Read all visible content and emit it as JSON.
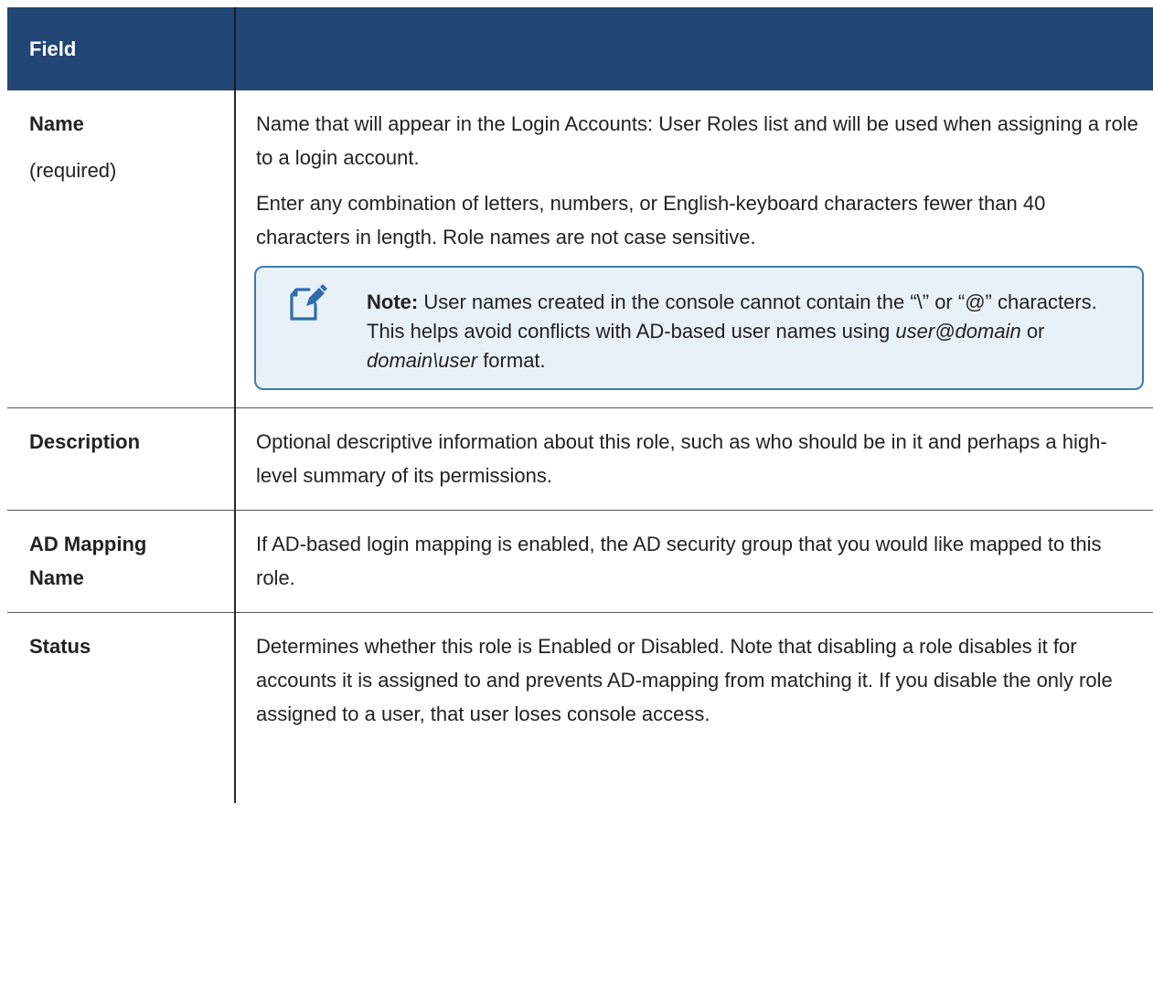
{
  "table": {
    "header": {
      "col1": "Field",
      "col2": ""
    },
    "rows": {
      "name": {
        "field": "Name",
        "field_sub": "(required)",
        "desc_p1": "Name that will appear in the Login Accounts: User Roles list and will be used when assigning a role to a login account.",
        "desc_p2": "Enter any combination of letters, numbers, or English-keyboard characters fewer than 40 characters in length. Role names are not case sensitive.",
        "note": {
          "icon": "note-pencil-icon",
          "label": "Note:",
          "text1": " User names created in the console cannot contain the “\\” or “@” characters. This helps avoid conflicts with AD-based user names using ",
          "em1": "user@domain",
          "text2": " or ",
          "em2": "domain\\user",
          "text3": " format."
        }
      },
      "description": {
        "field": "Description",
        "desc": "Optional descriptive information about this role, such as who should be in it and perhaps a high-level summary of its permissions."
      },
      "ad_mapping": {
        "field_line1": "AD Mapping",
        "field_line2": "Name",
        "desc": "If AD-based login mapping is enabled, the AD security group that you would like mapped to this role."
      },
      "status": {
        "field": "Status",
        "desc": "Determines whether this role is Enabled or Disabled. Note that disabling a role disables it for accounts it is assigned to and prevents AD-mapping from matching it. If you disable the only role assigned to a user, that user loses console access."
      }
    }
  },
  "colors": {
    "header_bg": "#224676",
    "note_bg": "#e9f1f8",
    "note_border": "#3e7ab6"
  }
}
